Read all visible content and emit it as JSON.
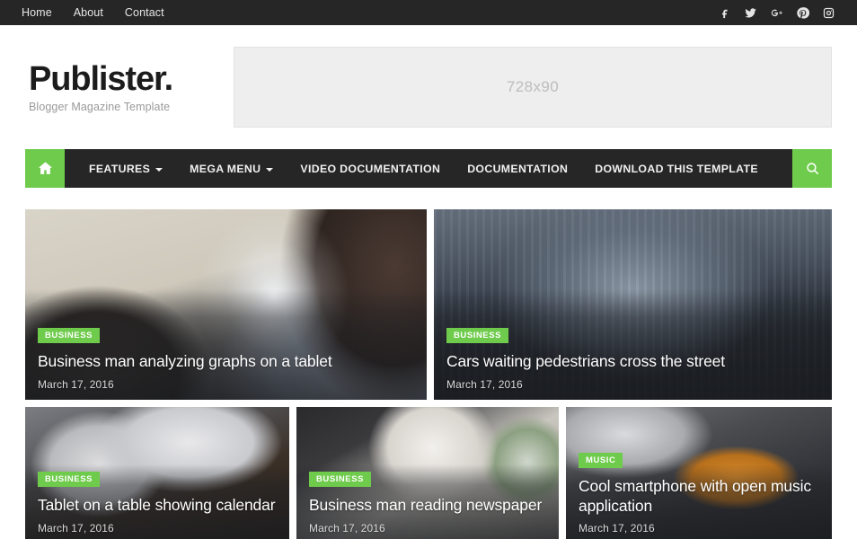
{
  "topbar": {
    "links": [
      {
        "label": "Home"
      },
      {
        "label": "About"
      },
      {
        "label": "Contact"
      }
    ],
    "social": [
      {
        "name": "facebook-icon",
        "title": "Facebook"
      },
      {
        "name": "twitter-icon",
        "title": "Twitter"
      },
      {
        "name": "google-plus-icon",
        "title": "Google Plus"
      },
      {
        "name": "pinterest-icon",
        "title": "Pinterest"
      },
      {
        "name": "instagram-icon",
        "title": "Instagram"
      }
    ]
  },
  "header": {
    "brand_title": "Publister.",
    "brand_subtitle": "Blogger Magazine Template",
    "ad_placeholder": "728x90"
  },
  "mainnav": {
    "home_icon": "home-icon",
    "search_icon": "search-icon",
    "items": [
      {
        "label": "FEATURES",
        "has_dropdown": true
      },
      {
        "label": "MEGA MENU",
        "has_dropdown": true
      },
      {
        "label": "VIDEO DOCUMENTATION",
        "has_dropdown": false
      },
      {
        "label": "DOCUMENTATION",
        "has_dropdown": false
      },
      {
        "label": "DOWNLOAD THIS TEMPLATE",
        "has_dropdown": false
      }
    ]
  },
  "posts": [
    {
      "category": "BUSINESS",
      "title": "Business man analyzing graphs on a tablet",
      "date": "March 17, 2016"
    },
    {
      "category": "BUSINESS",
      "title": "Cars waiting pedestrians cross the street",
      "date": "March 17, 2016"
    },
    {
      "category": "BUSINESS",
      "title": "Tablet on a table showing calendar",
      "date": "March 17, 2016"
    },
    {
      "category": "BUSINESS",
      "title": "Business man reading newspaper",
      "date": "March 17, 2016"
    },
    {
      "category": "MUSIC",
      "title": "Cool smartphone with open music application",
      "date": "March 17, 2016"
    }
  ],
  "colors": {
    "accent_green": "#6ecb4b",
    "dark_bar": "#262626",
    "badge_green": "#6ecb4b",
    "ad_background": "#eeeeee"
  }
}
